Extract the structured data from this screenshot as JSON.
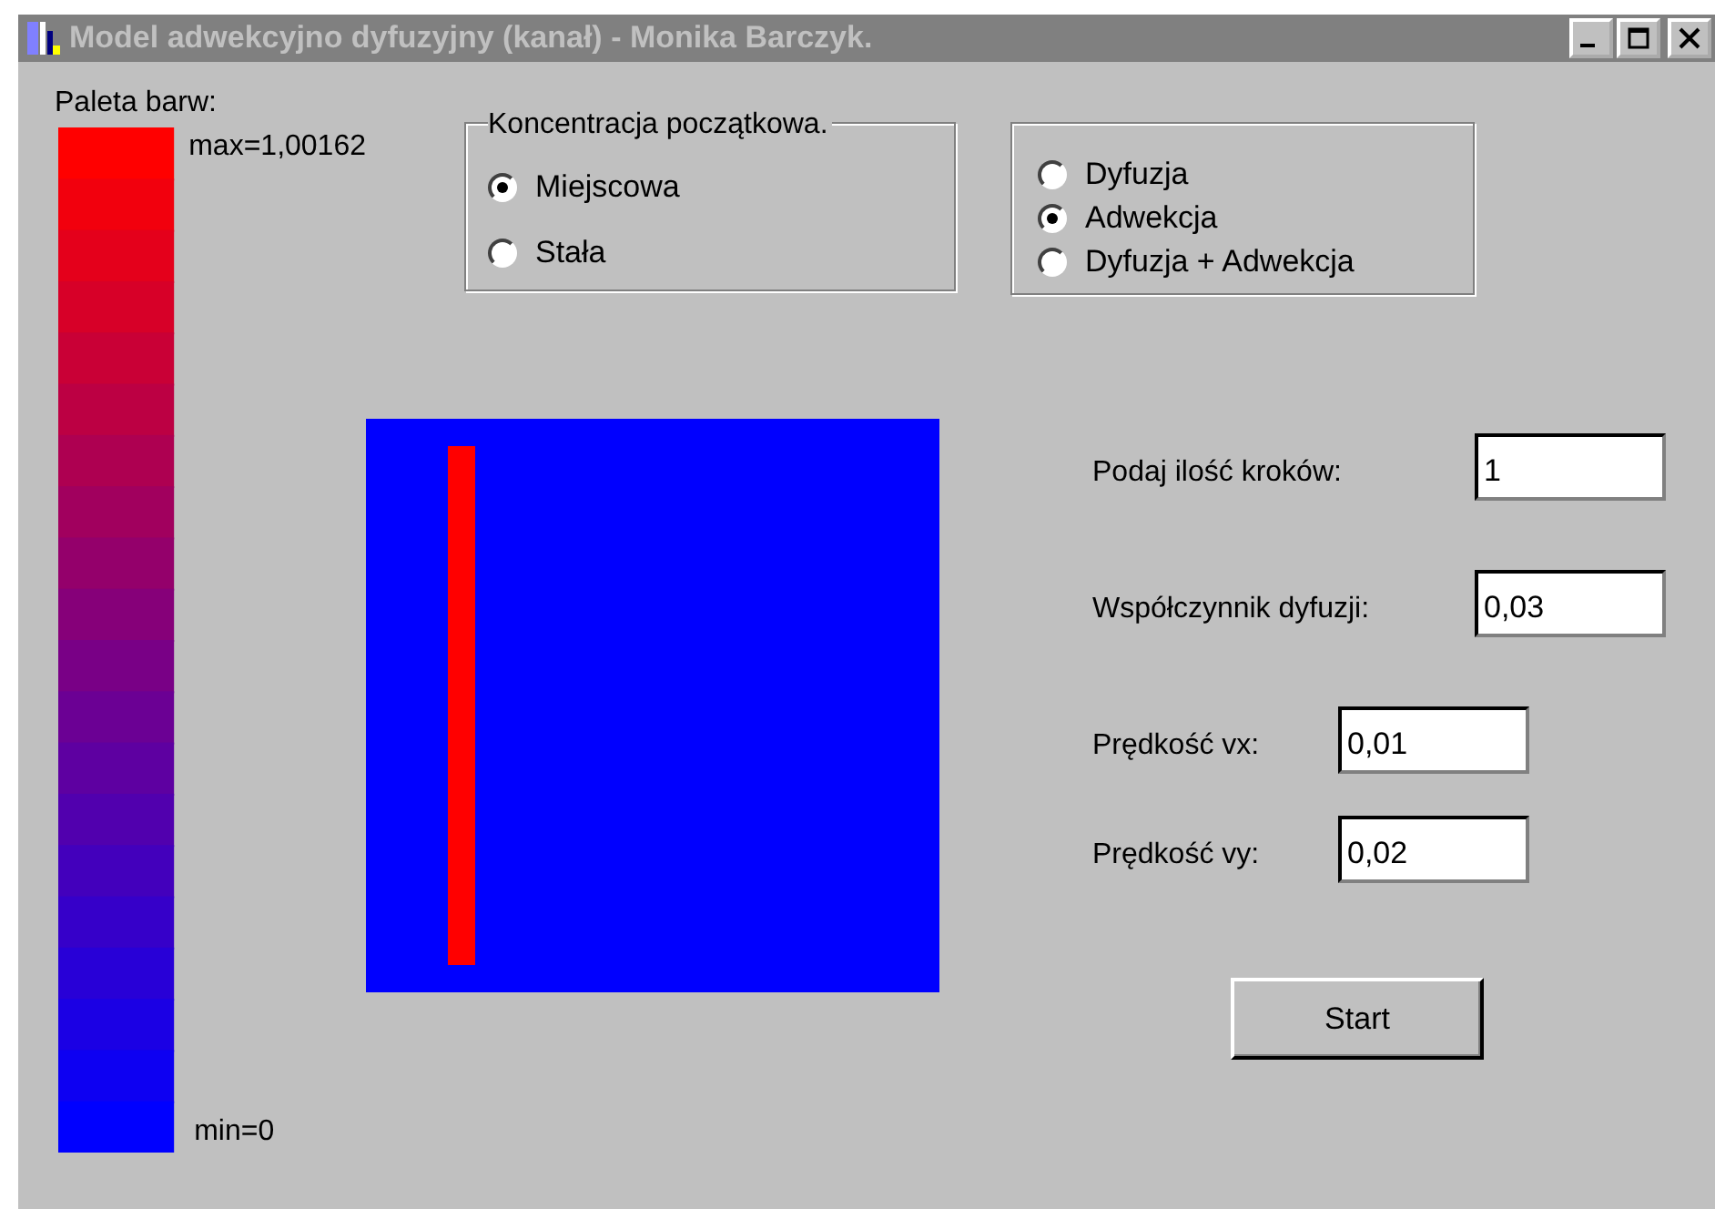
{
  "window": {
    "title": "Model adwekcyjno dyfuzyjny (kanał) - Monika Barczyk."
  },
  "palette": {
    "label": "Paleta barw:",
    "max_label": "max=1,00162",
    "min_label": "min=0"
  },
  "initial_concentration": {
    "legend": "Koncentracja początkowa.",
    "options": [
      {
        "label": "Miejscowa",
        "selected": true
      },
      {
        "label": "Stała",
        "selected": false
      }
    ]
  },
  "model": {
    "options": [
      {
        "label": "Dyfuzja",
        "selected": false
      },
      {
        "label": "Adwekcja",
        "selected": true
      },
      {
        "label": "Dyfuzja + Adwekcja",
        "selected": false
      }
    ]
  },
  "fields": [
    {
      "label": "Podaj ilość kroków:",
      "value": "1"
    },
    {
      "label": "Współczynnik dyfuzji:",
      "value": "0,03"
    },
    {
      "label": "Prędkość vx:",
      "value": "0,01"
    },
    {
      "label": "Prędkość vy:",
      "value": "0,02"
    }
  ],
  "start_button": "Start"
}
